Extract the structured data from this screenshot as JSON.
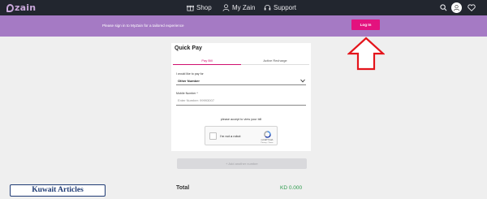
{
  "nav": {
    "logo_text": "zain",
    "items": [
      {
        "label": "Shop",
        "icon": "gift-icon"
      },
      {
        "label": "My Zain",
        "icon": "person-icon"
      },
      {
        "label": "Support",
        "icon": "support-icon"
      }
    ],
    "right_icons": [
      "search-icon",
      "avatar-icon",
      "heart-icon"
    ]
  },
  "banner": {
    "message": "Please sign in to MyZain for a tailored experience",
    "login_label": "Log In",
    "color": "#a57ac4",
    "button_color": "#e3127e"
  },
  "quick_pay": {
    "title": "Quick Pay",
    "tabs": [
      {
        "label": "Pay Bill",
        "active": true
      },
      {
        "label": "Active Recharge",
        "active": false
      }
    ],
    "want_label": "I would like to pay for",
    "selected_option": "Other Number",
    "mobile_label": "Mobile Number *",
    "mobile_placeholder": "Enter Number: 99993007",
    "captcha_prompt": "please accept to view your bill",
    "captcha_label": "I'm not a robot",
    "captcha_brand": "reCAPTCHA",
    "captcha_terms": "Privacy - Terms"
  },
  "add_button_label": "+ Add another number",
  "total": {
    "label": "Total",
    "value": "KD 0.000"
  },
  "watermark": "Kuwait Articles"
}
